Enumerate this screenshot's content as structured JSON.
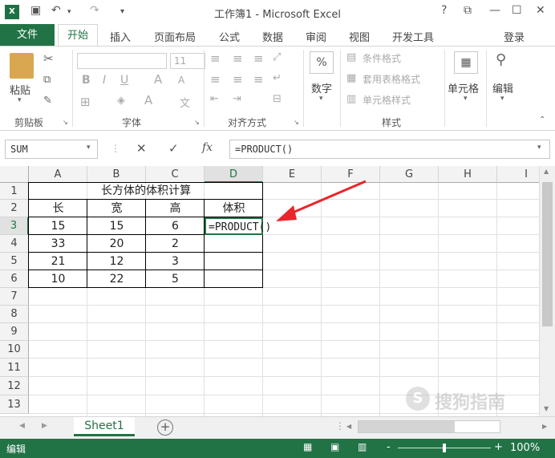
{
  "window": {
    "title": "工作簿1 - Microsoft Excel",
    "help": "?",
    "app_icon": "excel-icon"
  },
  "tabs": {
    "file": "文件",
    "home": "开始",
    "insert": "插入",
    "page_layout": "页面布局",
    "formulas": "公式",
    "data": "数据",
    "review": "审阅",
    "view": "视图",
    "developer": "开发工具",
    "signin": "登录"
  },
  "ribbon": {
    "clipboard": {
      "paste": "粘贴",
      "group": "剪贴板"
    },
    "font": {
      "size": "11",
      "bold": "B",
      "italic": "I",
      "underline": "U",
      "grow": "A",
      "shrink": "A",
      "color": "A",
      "phonetic": "文",
      "group": "字体"
    },
    "alignment": {
      "group": "对齐方式"
    },
    "number": {
      "percent": "%",
      "label": "数字"
    },
    "styles": {
      "conditional": "条件格式",
      "table": "套用表格格式",
      "cell": "单元格样式",
      "group": "样式"
    },
    "cells": {
      "label": "单元格"
    },
    "editing": {
      "label": "编辑"
    }
  },
  "formula_bar": {
    "name_box": "SUM",
    "cancel": "✕",
    "enter": "✓",
    "fx": "fx",
    "content": "=PRODUCT()"
  },
  "columns": [
    "A",
    "B",
    "C",
    "D",
    "E",
    "F",
    "G",
    "H",
    "I"
  ],
  "rows": [
    "1",
    "2",
    "3",
    "4",
    "5",
    "6",
    "7",
    "8",
    "9",
    "10",
    "11",
    "12",
    "13"
  ],
  "table": {
    "title": "长方体的体积计算",
    "headers": [
      "长",
      "宽",
      "高",
      "体积"
    ],
    "data": [
      [
        "15",
        "15",
        "6",
        "=PRODUCT()"
      ],
      [
        "33",
        "20",
        "2",
        ""
      ],
      [
        "21",
        "12",
        "3",
        ""
      ],
      [
        "10",
        "22",
        "5",
        ""
      ]
    ]
  },
  "sheets": {
    "active": "Sheet1",
    "add": "+"
  },
  "status": {
    "mode": "编辑",
    "zoom": "100%",
    "zoom_minus": "-",
    "zoom_plus": "+"
  },
  "watermark": {
    "text": "搜狗指南"
  },
  "colors": {
    "excel_green": "#217346",
    "arrow_red": "#e8262b"
  }
}
